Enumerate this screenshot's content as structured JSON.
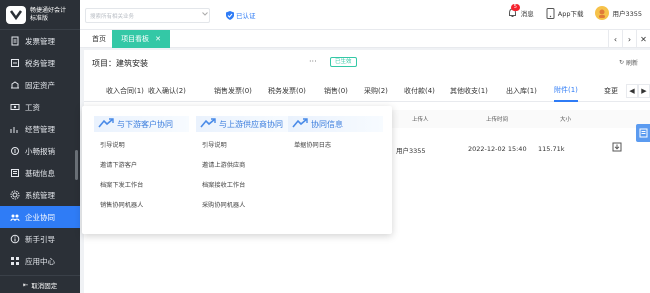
{
  "brand": {
    "line1": "畅捷通好会计",
    "line2": "标准版"
  },
  "sidebar": {
    "items": [
      {
        "label": "发票管理",
        "icon": "invoice-icon"
      },
      {
        "label": "税务管理",
        "icon": "tax-icon"
      },
      {
        "label": "固定资产",
        "icon": "asset-icon"
      },
      {
        "label": "工资",
        "icon": "salary-icon"
      },
      {
        "label": "经营管理",
        "icon": "business-icon"
      },
      {
        "label": "小畅报销",
        "icon": "reimburse-icon"
      },
      {
        "label": "基础信息",
        "icon": "info-icon"
      },
      {
        "label": "系统管理",
        "icon": "system-icon"
      },
      {
        "label": "企业协同",
        "icon": "collab-icon",
        "active": true
      },
      {
        "label": "新手引导",
        "icon": "guide-icon"
      },
      {
        "label": "应用中心",
        "icon": "apps-icon"
      }
    ],
    "collapse_label": "取消固定"
  },
  "header": {
    "search_placeholder": "搜索所有相关业务",
    "cert_label": "已认证",
    "messages_label": "消息",
    "messages_badge": "5",
    "app_download_label": "App下载",
    "user_label": "用户3355"
  },
  "page_tabs": {
    "home": "首页",
    "current": "项目看板"
  },
  "project": {
    "title": "项目：建筑安装",
    "dots": "···",
    "status": "已生效",
    "refresh_label": "刷新"
  },
  "subtabs": [
    "收入合同(1)",
    "收入确认(2)",
    "销售发票(0)",
    "税务发票(0)",
    "销售(0)",
    "采购(2)",
    "收付款(4)",
    "其他收支(1)",
    "出入库(1)",
    "附件(1)",
    "变更"
  ],
  "table": {
    "headers": {
      "uploader": "上传人",
      "upload_time": "上传时间",
      "size": "大小"
    },
    "row": {
      "uploader": "用户3355",
      "upload_time": "2022-12-02 15:40",
      "size": "115.71k"
    }
  },
  "popup": {
    "columns": [
      {
        "title": "与下游客户协同",
        "links": [
          "引导说明",
          "邀请下游客户",
          "档案下发工作台",
          "销售协同机器人"
        ]
      },
      {
        "title": "与上游供应商协同",
        "links": [
          "引导说明",
          "邀请上游供应商",
          "档案接收工作台",
          "采购协同机器人"
        ]
      },
      {
        "title": "协同信息",
        "links": [
          "单据协同日志"
        ]
      }
    ]
  },
  "colors": {
    "accent": "#2f7cf6",
    "sidebar_bg": "#2b3037",
    "tab_active": "#34c8a6"
  }
}
